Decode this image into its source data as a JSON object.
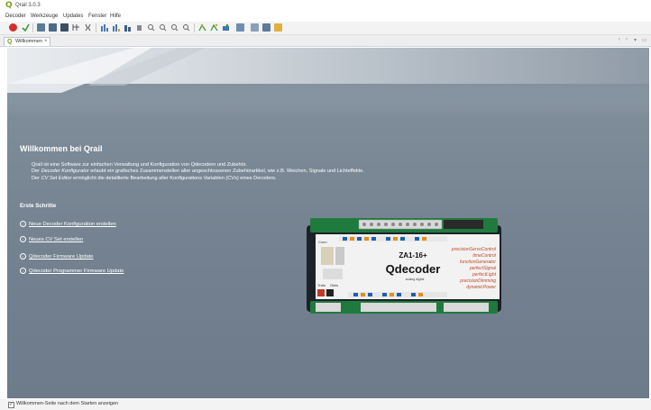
{
  "window": {
    "title": "Qrail 3.0.3",
    "app_icon": "Q"
  },
  "menu": [
    "Decoder",
    "Werkzeuge",
    "Updates",
    "Fenster",
    "Hilfe"
  ],
  "toolbar": {
    "buttons": [
      "stop-icon",
      "check-icon",
      "decoder-read-icon",
      "decoder-write-icon",
      "decoder-icon",
      "settings-icon",
      "bars-icon",
      "bars-add-icon",
      "bars-remove-icon",
      "zoom-icon",
      "zoom-in-icon",
      "zoom-out-icon",
      "zoom-reset-icon",
      "signal-icon",
      "signal-add-icon",
      "signal-edit-icon",
      "save-icon",
      "print-icon",
      "export-icon",
      "folder-icon"
    ]
  },
  "tab": {
    "label": "Willkommen",
    "close": "×",
    "icon": "Q"
  },
  "tab_nav": {
    "prev": "‹",
    "next": "›",
    "menu": "▾",
    "maximize": "▭"
  },
  "welcome": {
    "title": "Willkommen bei Qrail",
    "intro": {
      "line1": "Qrail ist eine Software zur einfachen Verwaltung und Konfiguration von Qdecodern und Zubehör.",
      "line2_pre": "Der ",
      "line2_em": "Decoder Konfigurator",
      "line2_post": " erlaubt ein grafisches Zusammenstellen aller angeschlossenen Zubehörartikel, wie z.B. Weichen, Signale und Lichteffekte.",
      "line3_pre": "Der ",
      "line3_em": "CV Set Editor",
      "line3_post": " ermöglicht die detaillierte Bearbeitung aller Konfigurations Variablen (CVs) eines Decoders."
    },
    "steps_title": "Erste Schritte",
    "steps": [
      "Neue Decoder Konfiguration erstellen",
      "Neues CV Set erstellen",
      "Qdecoder Firmware Update",
      "Qdecoder Programmer Firmware Update"
    ]
  },
  "product": {
    "model": "ZA1-16+",
    "brand": "Qdecoder",
    "brand_sub": "analog digital",
    "features": [
      "precisionServoControl",
      "timeControl",
      "functionGenerator",
      "perfectSignal",
      "perfectLight",
      "precisionDimming",
      "dynamicPower"
    ],
    "labels": {
      "conn": "Conn",
      "trafo": "Trafo",
      "gleis": "Gleis"
    }
  },
  "status": {
    "checkbox_label": "Willkommen-Seite nach dem Starten anzeigen",
    "checked": true
  },
  "colors": {
    "accent": "#7aa11a",
    "main_bg": "#7d8a97",
    "board_green": "#1f7a3e"
  }
}
